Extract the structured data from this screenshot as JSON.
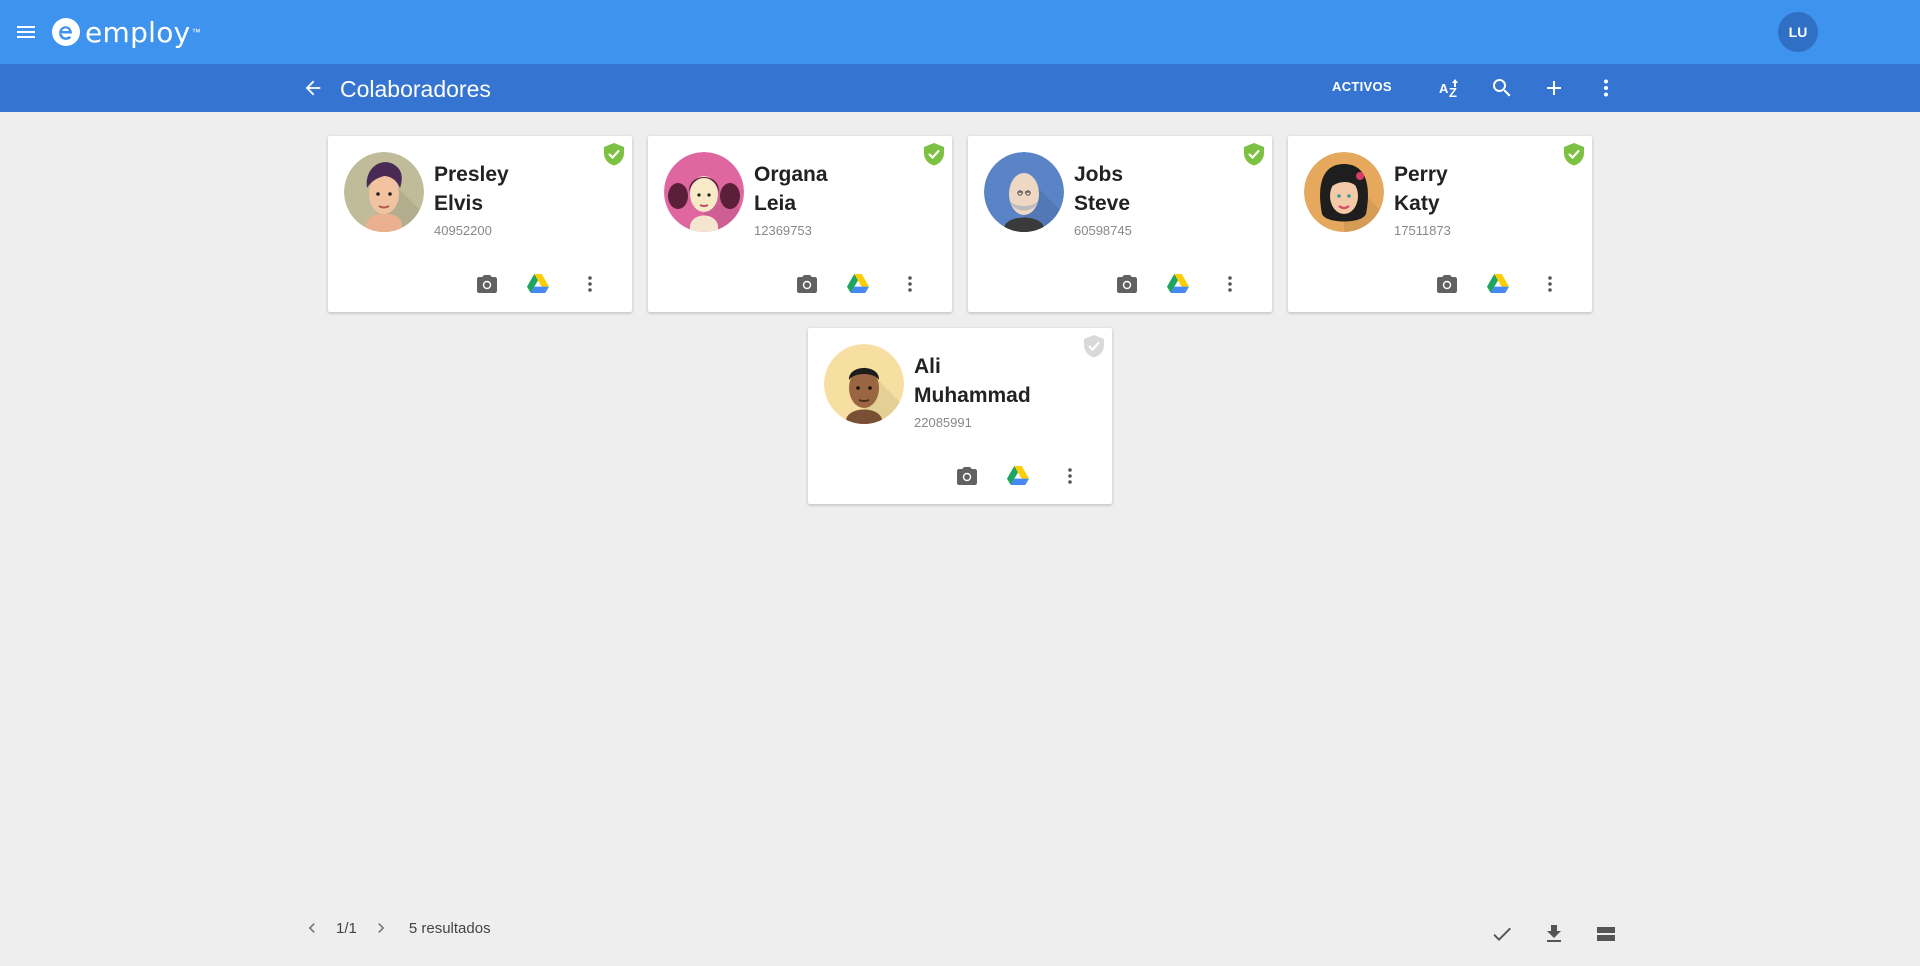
{
  "app": {
    "brand": "employ",
    "brand_mark": "™",
    "user_initials": "LU"
  },
  "subbar": {
    "title": "Colaboradores",
    "filter_label": "ACTIVOS",
    "icons": [
      "back-arrow-icon",
      "sort-az-icon",
      "search-icon",
      "add-icon",
      "more-vert-icon"
    ]
  },
  "employees": [
    {
      "last_name": "Presley",
      "first_name": "Elvis",
      "doc": "40952200",
      "verified": true,
      "avatar_bg": "#c0bb98"
    },
    {
      "last_name": "Organa",
      "first_name": "Leia",
      "doc": "12369753",
      "verified": true,
      "avatar_bg": "#e066a0"
    },
    {
      "last_name": "Jobs",
      "first_name": "Steve",
      "doc": "60598745",
      "verified": true,
      "avatar_bg": "#5a84c6"
    },
    {
      "last_name": "Perry",
      "first_name": "Katy",
      "doc": "17511873",
      "verified": true,
      "avatar_bg": "#e6a85c"
    },
    {
      "last_name": "Ali",
      "first_name": "Muhammad",
      "doc": "22085991",
      "verified": false,
      "avatar_bg": "#f6dfa0"
    }
  ],
  "card_actions": [
    "camera-icon",
    "google-drive-icon",
    "more-vert-icon"
  ],
  "pagination": {
    "page": "1/1",
    "results": "5 resultados"
  },
  "footer_actions": [
    "check-icon",
    "download-icon",
    "view-list-icon"
  ],
  "colors": {
    "primary": "#3d93ee",
    "primary_dark": "#3574d1",
    "verified": "#7cc142",
    "unverified": "#d9d9d9"
  }
}
